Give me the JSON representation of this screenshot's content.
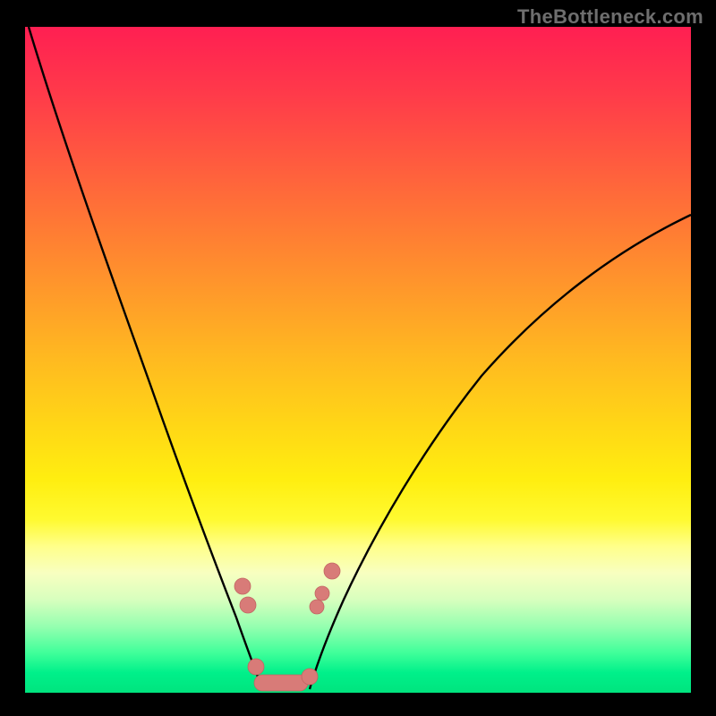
{
  "watermark": "TheBottleneck.com",
  "chart_data": {
    "type": "line",
    "title": "",
    "xlabel": "",
    "ylabel": "",
    "xlim": [
      0,
      100
    ],
    "ylim": [
      0,
      100
    ],
    "grid": false,
    "legend": false,
    "series": [
      {
        "name": "left-curve",
        "x": [
          0,
          4,
          8,
          12,
          16,
          20,
          24,
          28,
          32,
          34,
          35.5
        ],
        "values": [
          100,
          90,
          78,
          66,
          54,
          42,
          31,
          21,
          12,
          6,
          0
        ]
      },
      {
        "name": "right-curve",
        "x": [
          43,
          45,
          48,
          52,
          58,
          66,
          75,
          85,
          95,
          100
        ],
        "values": [
          0,
          6,
          13,
          22,
          33,
          45,
          55,
          63,
          69,
          72
        ]
      }
    ],
    "markers": {
      "left_dots": [
        {
          "x": 32.5,
          "y": 16
        },
        {
          "x": 33.4,
          "y": 13
        }
      ],
      "right_dots": [
        {
          "x": 43.8,
          "y": 12
        },
        {
          "x": 44.5,
          "y": 14
        },
        {
          "x": 46.0,
          "y": 18
        }
      ],
      "bottom_bar": {
        "x_start": 34.4,
        "x_end": 42.5,
        "y": 1.5
      }
    },
    "gradient": {
      "top": "#ff1f52",
      "mid": "#ffd716",
      "bottom": "#00e47e"
    }
  },
  "colors": {
    "marker": "#d87b78",
    "marker_stroke": "#c26562",
    "curve": "#000000",
    "frame": "#000000",
    "watermark": "#6e6e6e"
  }
}
